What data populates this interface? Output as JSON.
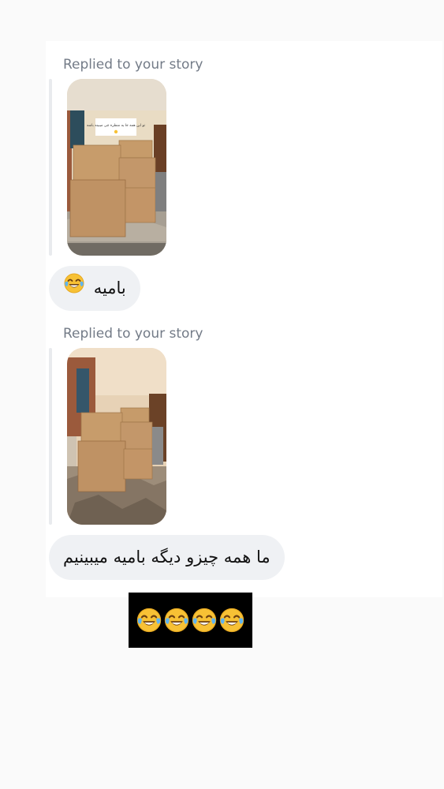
{
  "conversation": {
    "messages": [
      {
        "reply_label": "Replied to your story",
        "story_image": "story-photo-stacked-cardboard-boxes",
        "story_overlay_text": "تو این همه جا یه منظره چی میبینه باشه",
        "text": "بامیه",
        "emoji": "face-with-tears-of-joy-icon"
      },
      {
        "reply_label": "Replied to your story",
        "story_image": "story-photo-stacked-cardboard-boxes",
        "text": "ما همه چیزو دیگه بامیه میبینیم"
      }
    ],
    "sticker": {
      "emoji": "face-with-tears-of-joy-icon",
      "count": 4,
      "background": "#000000"
    }
  },
  "colors": {
    "page_bg": "#fafafa",
    "panel_bg": "#ffffff",
    "bubble_bg": "#eff1f4",
    "label_text": "#737b87",
    "emoji_face": "#f7c135"
  }
}
